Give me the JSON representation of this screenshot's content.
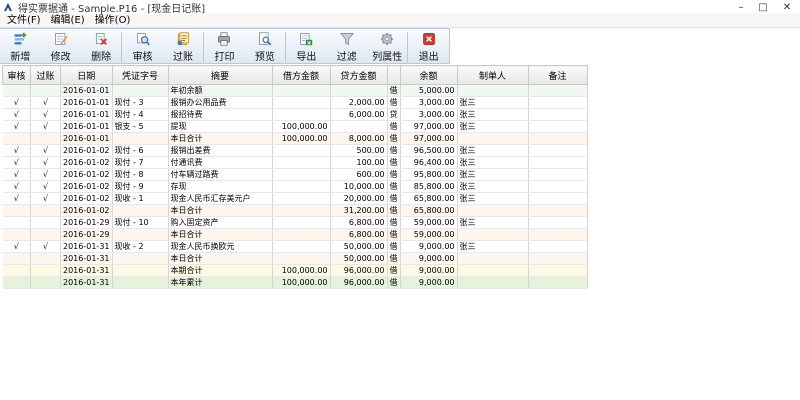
{
  "window": {
    "title": "得实票据通 - Sample.P16 - [现金日记账]",
    "minimize": "–",
    "maximize": "□",
    "close": "✕"
  },
  "menu": [
    {
      "label": "文件(F)"
    },
    {
      "label": "编辑(E)"
    },
    {
      "label": "操作(O)"
    }
  ],
  "toolbar": {
    "new": "新增",
    "edit": "修改",
    "delete": "删除",
    "audit": "审核",
    "post": "过账",
    "print": "打印",
    "preview": "预览",
    "export": "导出",
    "filter": "过滤",
    "columns": "列属性",
    "exit": "退出"
  },
  "colors": {
    "accent_red": "#d23a2e",
    "grid_header": "#e8e8e8",
    "day_total_row": "#fdf6ec",
    "period_total_row": "#fbfbe4",
    "year_total_row": "#e6f2da"
  },
  "table": {
    "columns": [
      "审核",
      "过账",
      "日期",
      "凭证字号",
      "摘要",
      "借方金额",
      "贷方金额",
      "",
      "余额",
      "制单人",
      "备注"
    ],
    "rows": [
      {
        "audit": "",
        "post": "",
        "date": "2016-01-01",
        "voucher": "",
        "summary": "年初余额",
        "debit": "",
        "credit": "",
        "dir": "借",
        "balance": "5,000.00",
        "maker": "",
        "note": "",
        "style": "row-open"
      },
      {
        "audit": "√",
        "post": "√",
        "date": "2016-01-01",
        "voucher": "现付 - 3",
        "summary": "报销办公用品费",
        "debit": "",
        "credit": "2,000.00",
        "dir": "借",
        "balance": "3,000.00",
        "maker": "张三",
        "note": "",
        "style": "row-white"
      },
      {
        "audit": "√",
        "post": "√",
        "date": "2016-01-01",
        "voucher": "现付 - 4",
        "summary": "报招待费",
        "debit": "",
        "credit": "6,000.00",
        "dir": "贷",
        "balance": "3,000.00",
        "maker": "张三",
        "note": "",
        "style": "row-white"
      },
      {
        "audit": "√",
        "post": "√",
        "date": "2016-01-01",
        "voucher": "银支 - 5",
        "summary": "提现",
        "debit": "100,000.00",
        "credit": "",
        "dir": "借",
        "balance": "97,000.00",
        "maker": "张三",
        "note": "",
        "style": "row-white"
      },
      {
        "audit": "",
        "post": "",
        "date": "2016-01-01",
        "voucher": "",
        "summary": "本日合计",
        "debit": "100,000.00",
        "credit": "8,000.00",
        "dir": "借",
        "balance": "97,000.00",
        "maker": "",
        "note": "",
        "style": "row-day"
      },
      {
        "audit": "√",
        "post": "√",
        "date": "2016-01-02",
        "voucher": "现付 - 6",
        "summary": "报销出差费",
        "debit": "",
        "credit": "500.00",
        "dir": "借",
        "balance": "96,500.00",
        "maker": "张三",
        "note": "",
        "style": "row-white"
      },
      {
        "audit": "√",
        "post": "√",
        "date": "2016-01-02",
        "voucher": "现付 - 7",
        "summary": "付通讯费",
        "debit": "",
        "credit": "100.00",
        "dir": "借",
        "balance": "96,400.00",
        "maker": "张三",
        "note": "",
        "style": "row-white"
      },
      {
        "audit": "√",
        "post": "√",
        "date": "2016-01-02",
        "voucher": "现付 - 8",
        "summary": "付车辆过路费",
        "debit": "",
        "credit": "600.00",
        "dir": "借",
        "balance": "95,800.00",
        "maker": "张三",
        "note": "",
        "style": "row-white"
      },
      {
        "audit": "√",
        "post": "√",
        "date": "2016-01-02",
        "voucher": "现付 - 9",
        "summary": "存现",
        "debit": "",
        "credit": "10,000.00",
        "dir": "借",
        "balance": "85,800.00",
        "maker": "张三",
        "note": "",
        "style": "row-white"
      },
      {
        "audit": "√",
        "post": "√",
        "date": "2016-01-02",
        "voucher": "现收 - 1",
        "summary": "现金人民币汇存美元户",
        "debit": "",
        "credit": "20,000.00",
        "dir": "借",
        "balance": "65,800.00",
        "maker": "张三",
        "note": "",
        "style": "row-white"
      },
      {
        "audit": "",
        "post": "",
        "date": "2016-01-02",
        "voucher": "",
        "summary": "本日合计",
        "debit": "",
        "credit": "31,200.00",
        "dir": "借",
        "balance": "65,800.00",
        "maker": "",
        "note": "",
        "style": "row-day"
      },
      {
        "audit": "",
        "post": "",
        "date": "2016-01-29",
        "voucher": "现付 - 10",
        "summary": "购入固定资产",
        "debit": "",
        "credit": "6,800.00",
        "dir": "借",
        "balance": "59,000.00",
        "maker": "张三",
        "note": "",
        "style": "row-white"
      },
      {
        "audit": "",
        "post": "",
        "date": "2016-01-29",
        "voucher": "",
        "summary": "本日合计",
        "debit": "",
        "credit": "6,800.00",
        "dir": "借",
        "balance": "59,000.00",
        "maker": "",
        "note": "",
        "style": "row-day"
      },
      {
        "audit": "√",
        "post": "√",
        "date": "2016-01-31",
        "voucher": "现收 - 2",
        "summary": "现金人民币换欧元",
        "debit": "",
        "credit": "50,000.00",
        "dir": "借",
        "balance": "9,000.00",
        "maker": "张三",
        "note": "",
        "style": "row-white"
      },
      {
        "audit": "",
        "post": "",
        "date": "2016-01-31",
        "voucher": "",
        "summary": "本日合计",
        "debit": "",
        "credit": "50,000.00",
        "dir": "借",
        "balance": "9,000.00",
        "maker": "",
        "note": "",
        "style": "row-day"
      },
      {
        "audit": "",
        "post": "",
        "date": "2016-01-31",
        "voucher": "",
        "summary": "本期合计",
        "debit": "100,000.00",
        "credit": "96,000.00",
        "dir": "借",
        "balance": "9,000.00",
        "maker": "",
        "note": "",
        "style": "row-period"
      },
      {
        "audit": "",
        "post": "",
        "date": "2016-01-31",
        "voucher": "",
        "summary": "本年累计",
        "debit": "100,000.00",
        "credit": "96,000.00",
        "dir": "借",
        "balance": "9,000.00",
        "maker": "",
        "note": "",
        "style": "row-year"
      }
    ]
  }
}
